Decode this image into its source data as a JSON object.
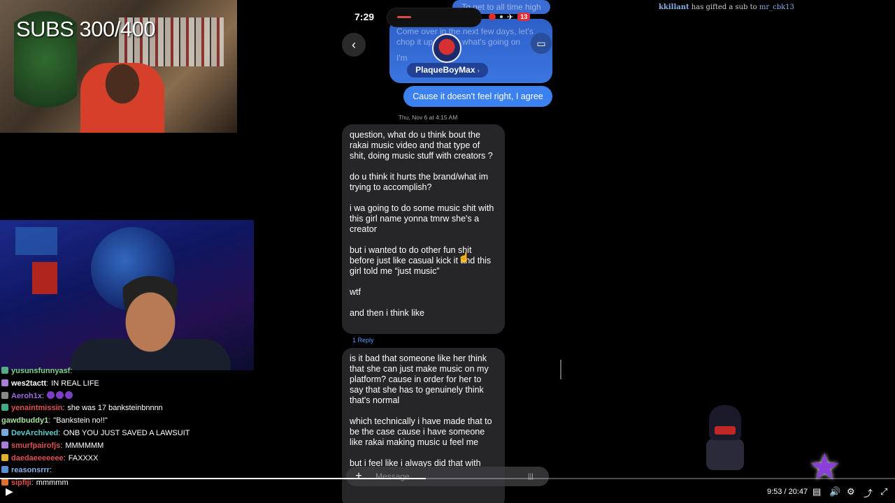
{
  "overlay": {
    "subs_text": "SUBS 300/400",
    "gift_user": "kkillant",
    "gift_text": " has gifted a sub to ",
    "gift_to": "mr_cbk13"
  },
  "chat": [
    {
      "user": "yusunsfunnyasf",
      "user_color": "#7bd389",
      "message": "",
      "badge_color": "#5a8"
    },
    {
      "user": "wes2tactt",
      "user_color": "#ffffff",
      "message": "IN REAL LIFE",
      "badge_color": "#a77fd9"
    },
    {
      "user": "Aeroh1x",
      "user_color": "#a06be0",
      "message": "",
      "badge_color": "#888",
      "emotes": 3
    },
    {
      "user": "yenaintmissin",
      "user_color": "#e05050",
      "message": "she was 17 banksteinbnnnn",
      "badge_color": "#4a8"
    },
    {
      "user": "gawdbuddy1",
      "user_color": "#a8e0a0",
      "message": "\"Bankstein no!!\"",
      "badge_color": ""
    },
    {
      "user": "DevArchived",
      "user_color": "#5ad0d0",
      "message": "ONB YOU JUST SAVED A LAWSUIT",
      "badge_color": "#7ad"
    },
    {
      "user": "smurfpairofjs",
      "user_color": "#e05050",
      "message": "MMMMMM",
      "badge_color": "#a77fd9"
    },
    {
      "user": "daedaeeeeeee",
      "user_color": "#e05050",
      "message": "FAXXXX",
      "badge_color": "#e0b030"
    },
    {
      "user": "reasonsrrr",
      "user_color": "#8ab0e8",
      "message": "",
      "badge_color": "#5a8fd0"
    },
    {
      "user": "sipfiji",
      "user_color": "#e05050",
      "message": "mmmmm",
      "badge_color": "#e07030"
    }
  ],
  "phone": {
    "time": "7:29",
    "battery": "13",
    "contact_name": "PlaqueBoyMax",
    "top_partial_1": "To get to all time high",
    "top_partial_2": "Come over in the next few days, let's chop it up and fix what's going on",
    "top_partial_3": "I'm",
    "sent_message": "Cause it doesn't feel right, I agree",
    "timestamp": "Thu, Nov 6 at 4:15 AM",
    "received_1": [
      "question, what do u think bout the rakai music video and that type of shit, doing music stuff with creators ?",
      "do u think it hurts the brand/what im trying to accomplish?",
      "i wa going to do some music shit with this girl name yonna tmrw she's a creator",
      "but i wanted to do other fun shit before just like casual kick it and this girl told me “just music”",
      "wtf",
      "and then i think like"
    ],
    "reply_link": "1 Reply",
    "received_2": [
      "is it bad that someone like her think that she can just make music on my platform? cause in order for her to say that she has to genuinely think that's normal",
      "which technically i have made that to be the case cause i have someone like rakai making music u feel me",
      "but i feel like i always did that with"
    ],
    "composer_placeholder": "Message..."
  },
  "player": {
    "current_time": "9:53",
    "duration": "20:47",
    "time_display": "9:53 / 20:47",
    "progress": 0.476
  }
}
